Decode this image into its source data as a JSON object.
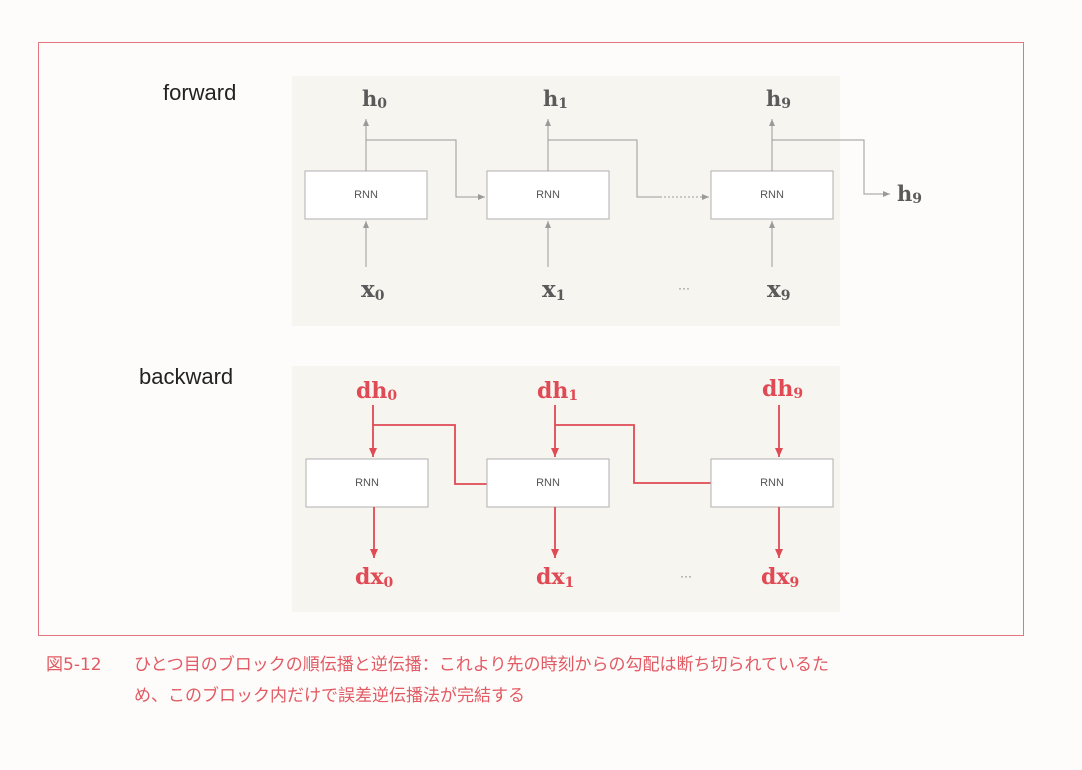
{
  "forward": {
    "label": "forward",
    "rnn_label": "RNN",
    "outputs": [
      "h",
      "h",
      "h"
    ],
    "output_subs": [
      "0",
      "1",
      "9"
    ],
    "inputs": [
      "x",
      "x",
      "x"
    ],
    "input_subs": [
      "0",
      "1",
      "9"
    ],
    "next_state": "h",
    "next_state_sub": "9",
    "ellipsis": "···"
  },
  "backward": {
    "label": "backward",
    "rnn_label": "RNN",
    "grads_in": [
      "dh",
      "dh",
      "dh"
    ],
    "grads_in_subs": [
      "0",
      "1",
      "9"
    ],
    "grads_out": [
      "dx",
      "dx",
      "dx"
    ],
    "grads_out_subs": [
      "0",
      "1",
      "9"
    ],
    "ellipsis": "···"
  },
  "caption": {
    "number": "図5-12",
    "line1": "ひとつ目のブロックの順伝播と逆伝播：これより先の時刻からの勾配は断ち切られているた",
    "line2": "め、このブロック内だけで誤差逆伝播法が完結する"
  },
  "colors": {
    "frame": "#e3767e",
    "forward_line": "#9a9a9a",
    "backward_line": "#e04a55",
    "caption": "#e25a63"
  }
}
